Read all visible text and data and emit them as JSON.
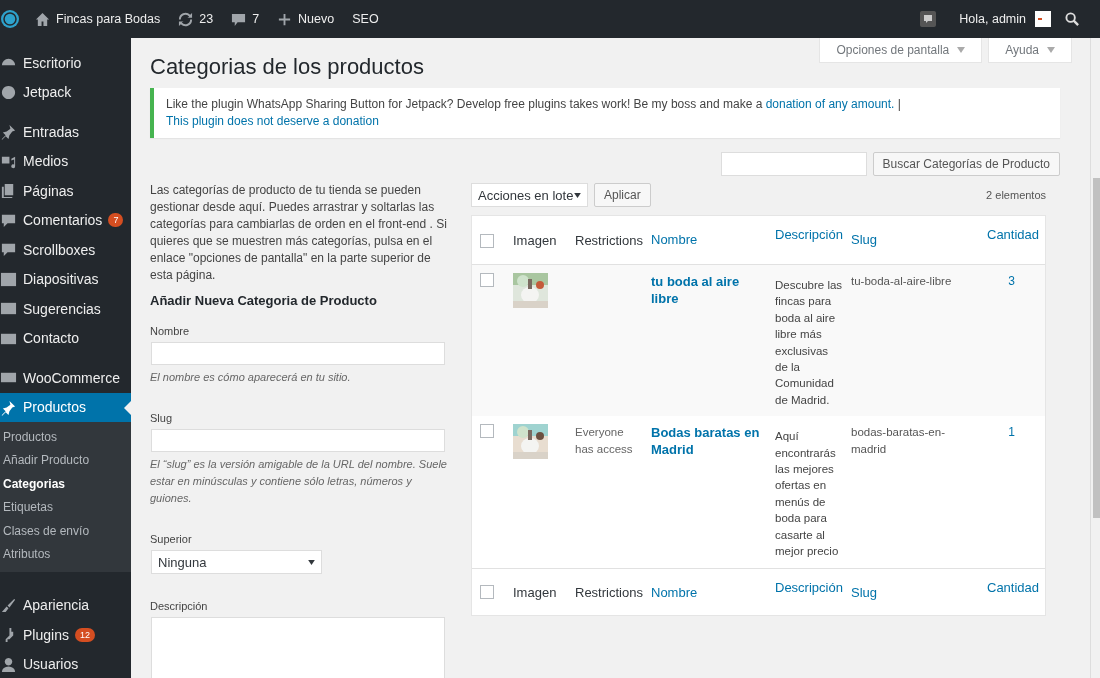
{
  "admin_bar": {
    "site": "Fincas para Bodas",
    "updates": "23",
    "comments": "7",
    "new": "Nuevo",
    "seo": "SEO",
    "greeting": "Hola, admin"
  },
  "sidebar": {
    "sections": [
      {
        "items": [
          {
            "label": "Escritorio",
            "selected": false
          },
          {
            "label": "Jetpack",
            "selected": false
          }
        ]
      },
      {
        "items": [
          {
            "label": "Entradas",
            "selected": false
          },
          {
            "label": "Medios",
            "selected": false
          },
          {
            "label": "Páginas",
            "selected": false
          },
          {
            "label": "Comentarios",
            "badge": "7",
            "selected": false
          },
          {
            "label": "Scrollboxes",
            "selected": false
          },
          {
            "label": "Diapositivas",
            "selected": false
          },
          {
            "label": "Sugerencias",
            "selected": false
          },
          {
            "label": "Contacto",
            "selected": false
          }
        ]
      },
      {
        "items": [
          {
            "label": "WooCommerce",
            "selected": false
          },
          {
            "label": "Productos",
            "selected": true,
            "children": [
              {
                "label": "Productos",
                "selected": false
              },
              {
                "label": "Añadir Producto",
                "selected": false
              },
              {
                "label": "Categorias",
                "selected": true
              },
              {
                "label": "Etiquetas",
                "selected": false
              },
              {
                "label": "Clases de envío",
                "selected": false
              },
              {
                "label": "Atributos",
                "selected": false
              }
            ]
          },
          {
            "label": "Apariencia",
            "selected": false
          },
          {
            "label": "Plugins",
            "badge": "12",
            "selected": false
          },
          {
            "label": "Usuarios",
            "selected": false
          }
        ]
      }
    ]
  },
  "screen_tabs": [
    "Opciones de pantalla",
    "Ayuda"
  ],
  "title": "Categorias de los productos",
  "notice": {
    "text": "Like the plugin WhatsApp Sharing Button for Jetpack? Develop free plugins takes work! Be my boss and make a ",
    "link": "donation of any amount.",
    "separator": " | ",
    "link_2": "This plugin does not deserve a donation"
  },
  "search": {
    "button": "Buscar Categorías de Producto"
  },
  "intro": "Las categorías de producto de tu tienda se pueden gestionar desde aquí. Puedes arrastrar y soltarlas las categorías para cambiarlas de orden en el front-end . Si quieres que se muestren más categorías, pulsa en el enlace \"opciones de pantalla\" en la parte superior de esta página.",
  "form": {
    "heading": "Añadir Nueva Categoria de Producto",
    "name": {
      "label": "Nombre",
      "hint": "El nombre es cómo aparecerá en tu sitio."
    },
    "slug": {
      "label": "Slug",
      "hint": "El “slug” es la versión amigable de la URL del nombre. Suele estar en minúsculas y contiene sólo letras, números y guiones."
    },
    "parent": {
      "label": "Superior",
      "value": "Ninguna"
    },
    "description": {
      "label": "Descripción"
    }
  },
  "bulk": {
    "select": "Acciones en lote",
    "apply": "Aplicar",
    "count": "2 elementos"
  },
  "table": {
    "select_all_checked": false,
    "footer_select_all_checked": false,
    "columns": [
      {
        "label": "Imagen",
        "sortable": false
      },
      {
        "label": "Restrictions",
        "sortable": false
      },
      {
        "label": "Nombre",
        "sortable": true
      },
      {
        "label": "Descripción",
        "sortable": true
      },
      {
        "label": "Slug",
        "sortable": true
      },
      {
        "label": "Cantidad",
        "sortable": true
      }
    ],
    "rows": [
      {
        "checked": false,
        "name": "tu boda al aire libre",
        "description": "Descubre las fincas para boda al aire libre más exclusivas de la Comunidad de Madrid.",
        "slug": "tu-boda-al-aire-libre",
        "count": "3"
      },
      {
        "checked": false,
        "restrictions": "Everyone has access",
        "name": "Bodas baratas en Madrid",
        "description": "Aquí encontrarás las mejores ofertas en menús de boda para casarte al mejor precio",
        "slug": "bodas-baratas-en-madrid",
        "count": "1"
      }
    ],
    "footer_columns": [
      {
        "label": "Imagen",
        "sortable": false
      },
      {
        "label": "Restrictions",
        "sortable": false
      },
      {
        "label": "Nombre",
        "sortable": true
      },
      {
        "label": "Descripción",
        "sortable": true
      },
      {
        "label": "Slug",
        "sortable": true
      },
      {
        "label": "Cantidad",
        "sortable": true
      }
    ]
  }
}
